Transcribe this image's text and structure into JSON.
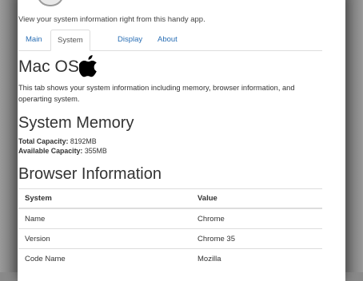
{
  "intro": "View your system information right from this handy app.",
  "tabs": [
    {
      "label": "Main"
    },
    {
      "label": "System"
    },
    {
      "label": "Display"
    },
    {
      "label": "About"
    }
  ],
  "active_tab": "System",
  "os_heading": "Mac OS",
  "os_icon": "apple-logo-icon",
  "description": "This tab shows your system information including memory, browser information, and operarting system.",
  "memory": {
    "heading": "System Memory",
    "total_label": "Total Capacity:",
    "total_value": "8192MB",
    "available_label": "Available Capacity:",
    "available_value": "355MB"
  },
  "browser": {
    "heading": "Browser Information",
    "columns": [
      "System",
      "Value"
    ],
    "rows": [
      [
        "Name",
        "Chrome"
      ],
      [
        "Version",
        "Chrome 35"
      ],
      [
        "Code Name",
        "Mozilla"
      ]
    ]
  },
  "colors": {
    "link": "#2a6fb5",
    "text": "#333333",
    "border": "#dddddd"
  }
}
